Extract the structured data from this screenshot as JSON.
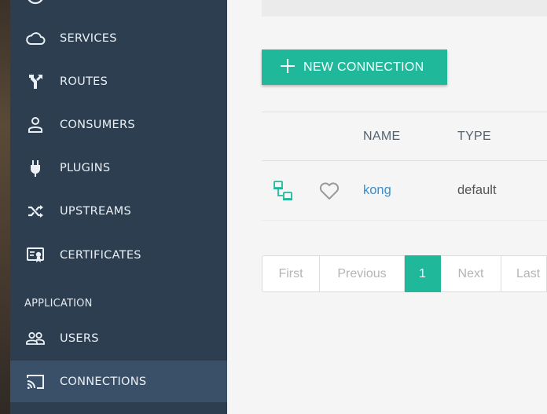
{
  "sidebar": {
    "items": [
      {
        "label": "SERVICES",
        "icon": "cloud-icon"
      },
      {
        "label": "ROUTES",
        "icon": "routes-icon"
      },
      {
        "label": "CONSUMERS",
        "icon": "user-icon"
      },
      {
        "label": "PLUGINS",
        "icon": "plug-icon"
      },
      {
        "label": "UPSTREAMS",
        "icon": "shuffle-icon"
      },
      {
        "label": "CERTIFICATES",
        "icon": "certificate-icon"
      }
    ],
    "section_application": "APPLICATION",
    "app_items": [
      {
        "label": "USERS",
        "icon": "users-icon"
      },
      {
        "label": "CONNECTIONS",
        "icon": "cast-icon",
        "active": true
      }
    ]
  },
  "toolbar": {
    "new_connection_label": "NEW CONNECTION"
  },
  "table": {
    "columns": [
      "NAME",
      "TYPE"
    ],
    "rows": [
      {
        "name": "kong",
        "type": "default"
      }
    ]
  },
  "pagination": {
    "first": "First",
    "previous": "Previous",
    "current": "1",
    "next": "Next",
    "last": "Last"
  },
  "colors": {
    "sidebar_bg": "#2c3e50",
    "sidebar_active": "#3a5068",
    "accent": "#1fb89b",
    "link": "#3b8fcf"
  }
}
